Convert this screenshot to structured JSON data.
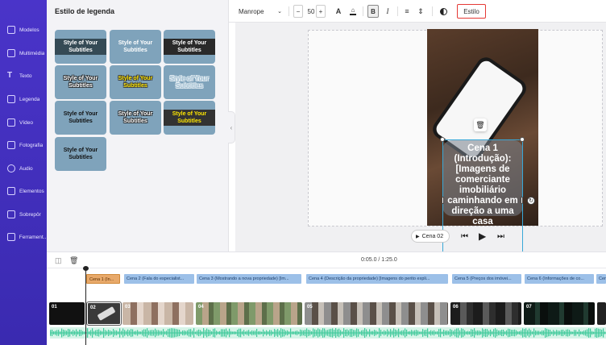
{
  "sidebar": {
    "items": [
      {
        "label": "Modelos",
        "icon": "templates-icon"
      },
      {
        "label": "Multimédia",
        "icon": "media-icon"
      },
      {
        "label": "Texto",
        "icon": "text-icon"
      },
      {
        "label": "Legenda",
        "icon": "subtitle-icon"
      },
      {
        "label": "Vídeo",
        "icon": "video-icon"
      },
      {
        "label": "Fotografia",
        "icon": "photo-icon"
      },
      {
        "label": "Áudio",
        "icon": "audio-icon"
      },
      {
        "label": "Elementos",
        "icon": "elements-icon"
      },
      {
        "label": "Sobrepôr",
        "icon": "overlay-icon"
      },
      {
        "label": "Ferrament...",
        "icon": "tools-icon"
      }
    ]
  },
  "panel": {
    "title": "Estilo de legenda",
    "tile_text": "Style of Your Subtitles"
  },
  "toolbar": {
    "font": "Manrope",
    "font_size": "50",
    "minus": "−",
    "plus": "+",
    "bold": "B",
    "italic": "I",
    "style_button": "Estilo"
  },
  "canvas": {
    "caption": "Cena 1 (Introdução): [Imagens de comerciante imobiliário caminhando em direção a uma casa",
    "scene_selector": "Cena 02"
  },
  "timeline": {
    "time": "0:05.0 / 1:25.0",
    "scenes": [
      "Cena 1 (In...",
      "Cena 2 (Fala do especialist...",
      "Cena 3 (Mostrando a nova propriedade) [Im...",
      "Cena 4 (Descrição da propriedade) [Imagens do perito expli...",
      "Cena 5 (Preços dos imóvei...",
      "Cena 6 (Informações de co...",
      "Cena"
    ],
    "clips": [
      "01",
      "02",
      "03",
      "04",
      "05",
      "06",
      "07"
    ]
  },
  "colors": {
    "sidebar": "#4a34c9",
    "accent_selection": "#38a8d8",
    "style_button_border": "#e53935",
    "scene_label": "#9cc0e8",
    "waveform": "#3ec99a"
  }
}
